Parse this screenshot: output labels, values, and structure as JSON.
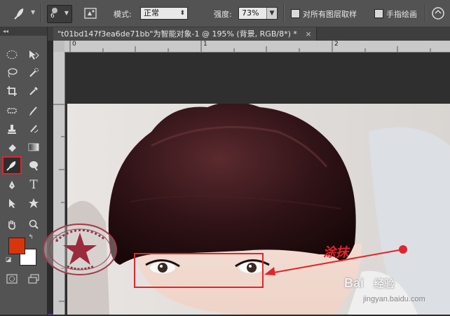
{
  "options_bar": {
    "brush_size": "6",
    "mode_label": "模式:",
    "mode_value": "正常",
    "strength_label": "强度:",
    "strength_value": "73%",
    "sample_all_layers_label": "对所有图层取样",
    "finger_painting_label": "手指绘画"
  },
  "document": {
    "tab_title": "\"t01bd147f3ea6de71bb\"为智能对象-1 @ 195% (背景, RGB/8*) *",
    "tab_close": "×",
    "ruler_h_marks": [
      "0",
      "1",
      "2"
    ],
    "ruler_v_marks": [
      "1"
    ]
  },
  "toolbar": {
    "header": "◂◂",
    "selected_tool": "smudge-tool"
  },
  "colors": {
    "foreground": "#d8360a",
    "background": "#ffffff",
    "annotation_red": "#e2252b"
  },
  "annotation": {
    "text": "涂抹"
  },
  "watermark": {
    "baidu_text": "Bai",
    "baidu_suffix": "经验",
    "url": "jingyan.baidu.com"
  }
}
